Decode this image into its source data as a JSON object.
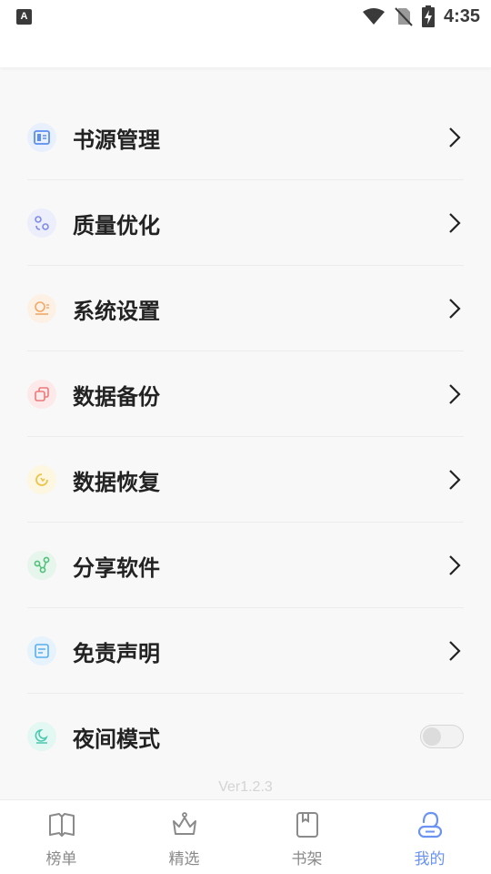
{
  "status_bar": {
    "notification_icon_letter": "A",
    "time": "4:35"
  },
  "menu": {
    "items": [
      {
        "label": "书源管理",
        "icon": "book-source-icon",
        "color": "#5b8ef0",
        "bg": "#e9f0fd"
      },
      {
        "label": "质量优化",
        "icon": "quality-icon",
        "color": "#7f8ae8",
        "bg": "#eceefc"
      },
      {
        "label": "系统设置",
        "icon": "settings-icon",
        "color": "#f0a868",
        "bg": "#fdf1e6"
      },
      {
        "label": "数据备份",
        "icon": "backup-icon",
        "color": "#ec7a7a",
        "bg": "#fde9e9"
      },
      {
        "label": "数据恢复",
        "icon": "restore-icon",
        "color": "#ecc44a",
        "bg": "#fdf6e0"
      },
      {
        "label": "分享软件",
        "icon": "share-icon",
        "color": "#52c07a",
        "bg": "#e6f6ec"
      },
      {
        "label": "免责声明",
        "icon": "disclaimer-icon",
        "color": "#5aaeea",
        "bg": "#e6f3fc"
      },
      {
        "label": "夜间模式",
        "icon": "night-mode-icon",
        "color": "#4cc9b0",
        "bg": "#e3f7f3"
      }
    ],
    "night_mode_enabled": false
  },
  "version": "Ver1.2.3",
  "bottom_nav": {
    "items": [
      {
        "label": "榜单",
        "icon": "book-open-icon"
      },
      {
        "label": "精选",
        "icon": "crown-icon"
      },
      {
        "label": "书架",
        "icon": "bookshelf-icon"
      },
      {
        "label": "我的",
        "icon": "profile-icon"
      }
    ],
    "active": "我的",
    "active_color": "#6a93f2",
    "inactive_color": "#8a8a8a"
  }
}
